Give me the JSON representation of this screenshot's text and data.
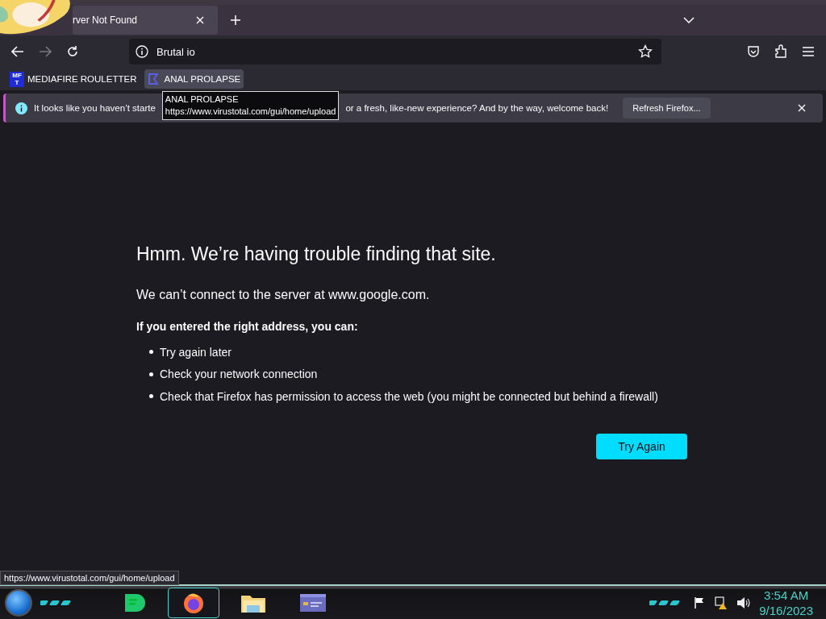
{
  "tab": {
    "title": "rver Not Found",
    "selected": true
  },
  "address": {
    "value": "Brutal io"
  },
  "bookmarks": [
    {
      "label": "MEDIAFIRE ROULETTER",
      "icon_text": "MF",
      "icon_sub": "T",
      "hovered": false
    },
    {
      "label": "ANAL PROLAPSE",
      "hovered": true
    }
  ],
  "tooltip": {
    "title": "ANAL PROLAPSE",
    "url": "https://www.virustotal.com/gui/home/upload"
  },
  "notification": {
    "text_start": "It looks like you haven’t starte",
    "text_end": "or a fresh, like-new experience? And by the way, welcome back!",
    "button": "Refresh Firefox..."
  },
  "error": {
    "title": "Hmm. We’re having trouble finding that site.",
    "subtitle": "We can’t connect to the server at www.google.com.",
    "heading": "If you entered the right address, you can:",
    "items": [
      "Try again later",
      "Check your network connection",
      "Check that Firefox has permission to access the web (you might be connected but behind a firewall)"
    ],
    "button": "Try Again"
  },
  "status_url": "https://www.virustotal.com/gui/home/upload",
  "taskbar": {
    "apps": [
      {
        "kind": "chat",
        "active": false
      },
      {
        "kind": "browser",
        "active": true
      },
      {
        "kind": "folder",
        "active": false
      },
      {
        "kind": "window",
        "active": false
      }
    ],
    "time": "3:54 AM",
    "date": "9/16/2023"
  }
}
